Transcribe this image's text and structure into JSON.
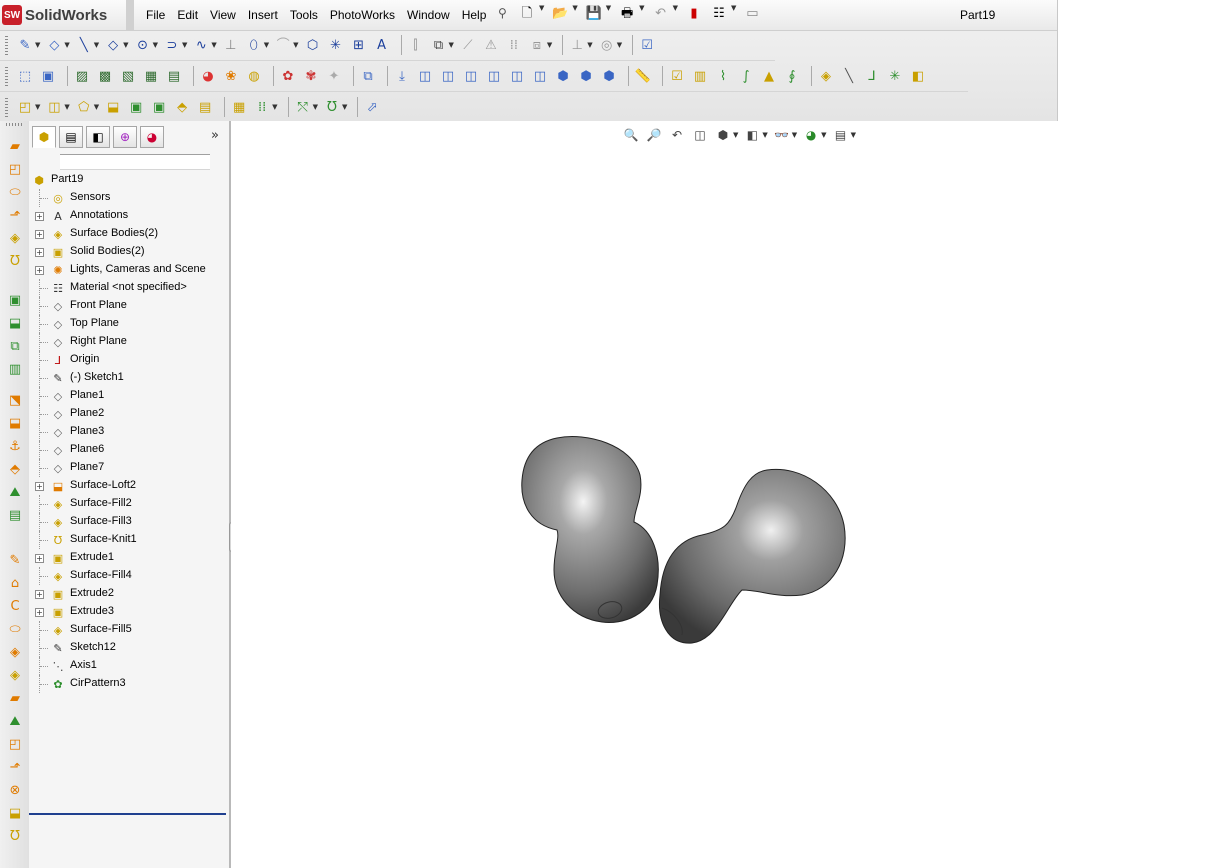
{
  "app": {
    "badge": "SW",
    "name": "SolidWorks"
  },
  "menu": [
    "File",
    "Edit",
    "View",
    "Insert",
    "Tools",
    "PhotoWorks",
    "Window",
    "Help"
  ],
  "document_title": "Part19",
  "feature_tree": {
    "root": "Part19",
    "items": [
      {
        "label": "Sensors",
        "icon": "sensor-icon",
        "expandable": false
      },
      {
        "label": "Annotations",
        "icon": "annotations-icon",
        "expandable": true
      },
      {
        "label": "Surface Bodies(2)",
        "icon": "surface-bodies-icon",
        "expandable": true
      },
      {
        "label": "Solid Bodies(2)",
        "icon": "solid-bodies-icon",
        "expandable": true
      },
      {
        "label": "Lights, Cameras and Scene",
        "icon": "lights-icon",
        "expandable": true
      },
      {
        "label": "Material <not specified>",
        "icon": "material-icon",
        "expandable": false
      },
      {
        "label": "Front Plane",
        "icon": "plane-icon",
        "expandable": false
      },
      {
        "label": "Top Plane",
        "icon": "plane-icon",
        "expandable": false
      },
      {
        "label": "Right Plane",
        "icon": "plane-icon",
        "expandable": false
      },
      {
        "label": "Origin",
        "icon": "origin-icon",
        "expandable": false
      },
      {
        "label": "(-) Sketch1",
        "icon": "sketch-icon",
        "expandable": false
      },
      {
        "label": "Plane1",
        "icon": "plane-icon",
        "expandable": false
      },
      {
        "label": "Plane2",
        "icon": "plane-icon",
        "expandable": false
      },
      {
        "label": "Plane3",
        "icon": "plane-icon",
        "expandable": false
      },
      {
        "label": "Plane6",
        "icon": "plane-icon",
        "expandable": false
      },
      {
        "label": "Plane7",
        "icon": "plane-icon",
        "expandable": false
      },
      {
        "label": "Surface-Loft2",
        "icon": "loft-icon",
        "expandable": true
      },
      {
        "label": "Surface-Fill2",
        "icon": "fill-icon",
        "expandable": false
      },
      {
        "label": "Surface-Fill3",
        "icon": "fill-icon",
        "expandable": false
      },
      {
        "label": "Surface-Knit1",
        "icon": "knit-icon",
        "expandable": false
      },
      {
        "label": "Extrude1",
        "icon": "extrude-icon",
        "expandable": true
      },
      {
        "label": "Surface-Fill4",
        "icon": "fill-icon",
        "expandable": false
      },
      {
        "label": "Extrude2",
        "icon": "extrude-icon",
        "expandable": true
      },
      {
        "label": "Extrude3",
        "icon": "extrude-icon",
        "expandable": true
      },
      {
        "label": "Surface-Fill5",
        "icon": "fill-icon",
        "expandable": false
      },
      {
        "label": "Sketch12",
        "icon": "sketch-icon",
        "expandable": false
      },
      {
        "label": "Axis1",
        "icon": "axis-icon",
        "expandable": false
      },
      {
        "label": "CirPattern3",
        "icon": "circular-pattern-icon",
        "expandable": false
      }
    ]
  },
  "colors": {
    "accent": "#c8202a",
    "rollback_bar": "#1f3f8f",
    "model": "#7a7a7a"
  }
}
